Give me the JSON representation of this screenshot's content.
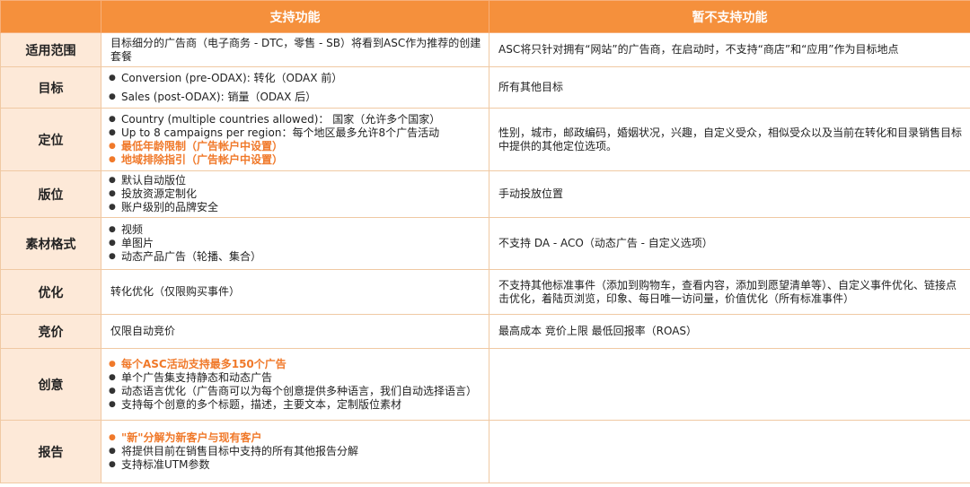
{
  "header": {
    "col_supported": "支持功能",
    "col_unsupported": "暂不支持功能"
  },
  "rows": [
    {
      "label": "适用范围",
      "supported_text": "目标细分的广告商（电子商务 - DTC，零售 - SB）将看到ASC作为推荐的创建套餐",
      "unsupported_text": "ASC将只针对拥有“网站”的广告商，在启动时，不支持“商店”和“应用”作为目标地点"
    },
    {
      "label": "目标",
      "supported_items": [
        {
          "text": "Conversion (pre-ODAX): 转化（ODAX 前）"
        },
        {
          "text": "Sales (post-ODAX): 销量（ODAX 后）"
        }
      ],
      "unsupported_text": "所有其他目标"
    },
    {
      "label": "定位",
      "supported_items": [
        {
          "text": "Country (multiple countries allowed)： 国家（允许多个国家）"
        },
        {
          "text": "Up to 8 campaigns per region：每个地区最多允许8个广告活动"
        },
        {
          "text": "最低年龄限制（广告帐户中设置）",
          "highlight": true
        },
        {
          "text": "地域排除指引（广告帐户中设置）",
          "highlight": true
        }
      ],
      "unsupported_text": "性别，城市，邮政编码，婚姻状况，兴趣，自定义受众，相似受众以及当前在转化和目录销售目标中提供的其他定位选项。"
    },
    {
      "label": "版位",
      "supported_items": [
        {
          "text": "默认自动版位"
        },
        {
          "text": "投放资源定制化"
        },
        {
          "text": "账户级别的品牌安全"
        }
      ],
      "unsupported_text": "手动投放位置"
    },
    {
      "label": "素材格式",
      "supported_items": [
        {
          "text": "视频"
        },
        {
          "text": "单图片"
        },
        {
          "text": "动态产品广告（轮播、集合）"
        }
      ],
      "unsupported_text": "不支持 DA - ACO（动态广告 - 自定义选项）"
    },
    {
      "label": "优化",
      "supported_text": "转化优化（仅限购买事件）",
      "unsupported_text": "不支持其他标准事件（添加到购物车，查看内容，添加到愿望清单等）、自定义事件优化、链接点击优化，着陆页浏览，印象、每日唯一访问量，价值优化（所有标准事件）"
    },
    {
      "label": "竞价",
      "supported_text": "仅限自动竞价",
      "unsupported_text": "最高成本 竞价上限 最低回报率（ROAS）"
    },
    {
      "label": "创意",
      "supported_items": [
        {
          "text": "每个ASC活动支持最多150个广告",
          "highlight": true
        },
        {
          "text": "单个广告集支持静态和动态广告"
        },
        {
          "text": "动态语言优化（广告商可以为每个创意提供多种语言，我们自动选择语言）"
        },
        {
          "text": "支持每个创意的多个标题，描述，主要文本，定制版位素材"
        }
      ],
      "unsupported_text": ""
    },
    {
      "label": "报告",
      "supported_items": [
        {
          "text": "\"新\"分解为新客户与现有客户",
          "highlight": true
        },
        {
          "text": "将提供目前在销售目标中支持的所有其他报告分解"
        },
        {
          "text": "支持标准UTM参数"
        }
      ],
      "unsupported_text": ""
    }
  ]
}
